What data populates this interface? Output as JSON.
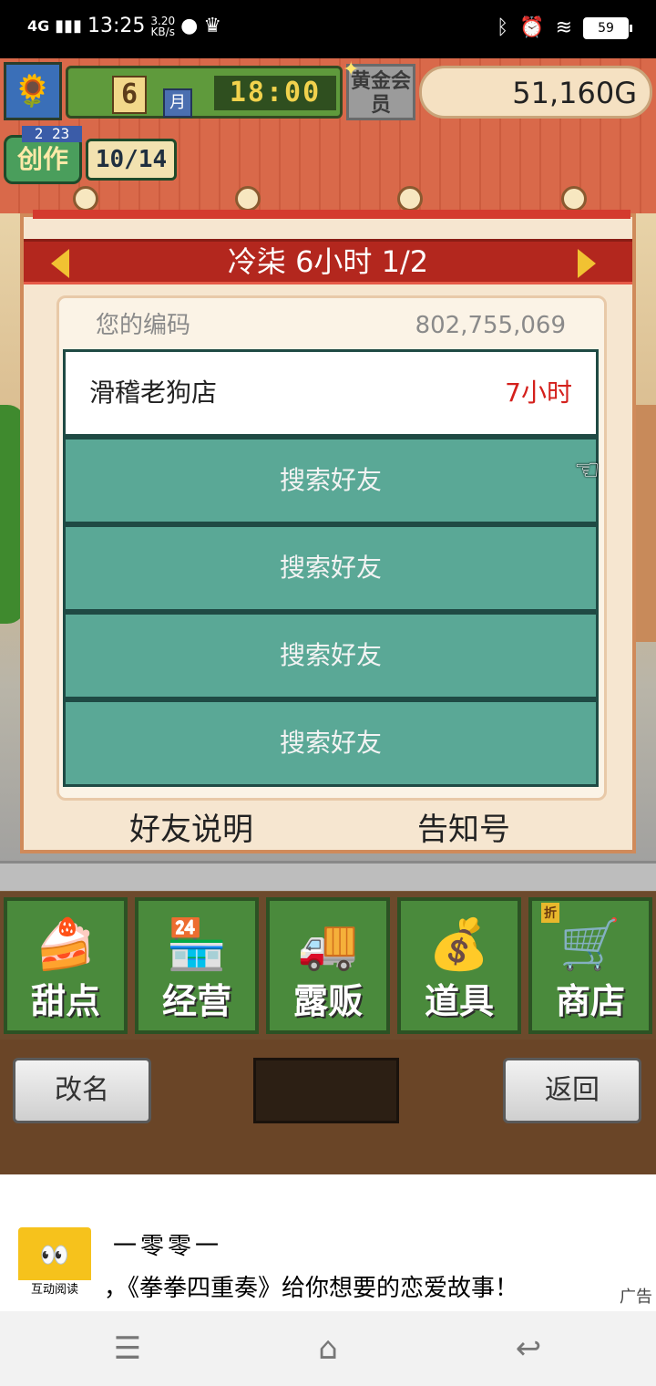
{
  "status_bar": {
    "network": "4G",
    "time": "13:25",
    "speed_value": "3.20",
    "speed_unit": "KB/s",
    "battery": "59"
  },
  "hud": {
    "month": "6",
    "month_unit": "月",
    "time": "18:00",
    "gold_member": "黄金会员",
    "money": "51,160G"
  },
  "create_badge": {
    "label": "创作",
    "date": "2 23",
    "count": "10/14"
  },
  "panel": {
    "title": "冷柒  6小时 1/2",
    "code_label": "您的编码",
    "code_value": "802,755,069",
    "friend": {
      "name": "滑稽老狗店",
      "hours": "7小时"
    },
    "search_slots": [
      "搜索好友",
      "搜索好友",
      "搜索好友",
      "搜索好友"
    ],
    "footer_left": "好友说明",
    "footer_right": "告知号"
  },
  "menu": [
    {
      "label": "甜点",
      "icon": "cake-icon",
      "glyph": "🍰"
    },
    {
      "label": "经营",
      "icon": "shop-building-icon",
      "glyph": "🏪"
    },
    {
      "label": "露贩",
      "icon": "food-truck-icon",
      "glyph": "🚚"
    },
    {
      "label": "道具",
      "icon": "items-bag-icon",
      "glyph": "💰"
    },
    {
      "label": "商店",
      "icon": "shopping-cart-icon",
      "glyph": "🛒",
      "tag": "折"
    }
  ],
  "bottom_buttons": {
    "rename": "改名",
    "back": "返回"
  },
  "ad": {
    "app_name": "互动阅读",
    "title": "一零零一",
    "description": "，《拳拳四重奏》给你想要的恋爱故事！",
    "tag": "广告"
  },
  "colors": {
    "panel_header": "#b3271e",
    "slot_search": "#5aa896",
    "hours_red": "#d4201c",
    "menu_green": "#4a8a3c"
  }
}
